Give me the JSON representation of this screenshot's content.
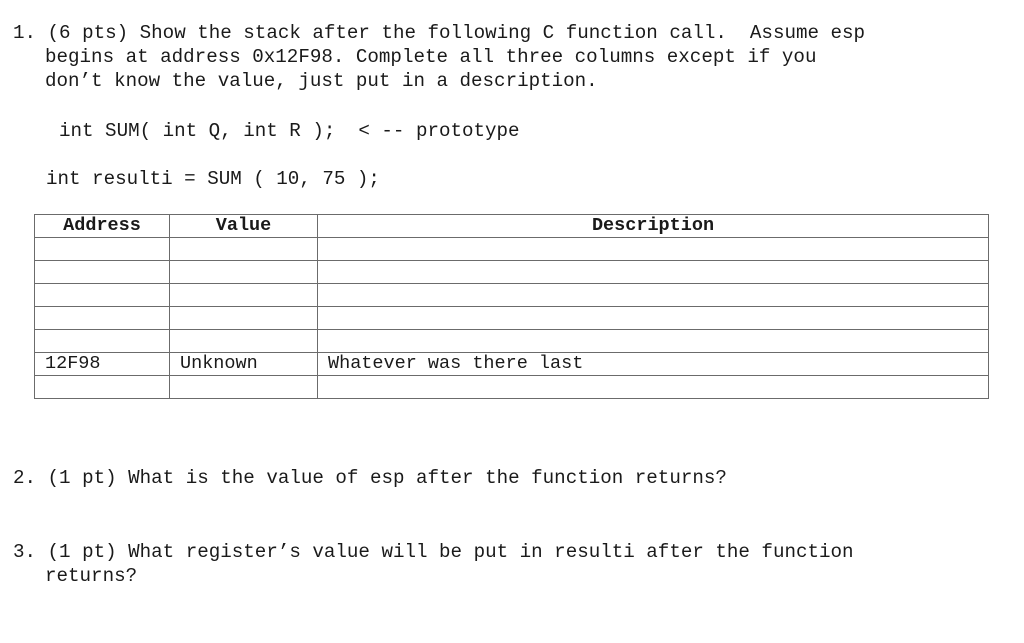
{
  "question1": {
    "lines": [
      "1. (6 pts) Show the stack after the following C function call.  Assume esp",
      "begins at address 0x12F98. Complete all three columns except if you",
      "don’t know the value, just put in a description."
    ],
    "code_prototype": "int SUM( int Q, int R );  < -- prototype",
    "code_call": "int resulti = SUM ( 10, 75 );"
  },
  "stack_table": {
    "headers": [
      "Address",
      "Value",
      "Description"
    ],
    "rows": [
      [
        "",
        "",
        ""
      ],
      [
        "",
        "",
        ""
      ],
      [
        "",
        "",
        ""
      ],
      [
        "",
        "",
        ""
      ],
      [
        "",
        "",
        ""
      ],
      [
        "12F98",
        "Unknown",
        "Whatever was there last"
      ],
      [
        "",
        "",
        ""
      ]
    ]
  },
  "question2": {
    "text": "2. (1 pt) What is the value of esp after the function returns?"
  },
  "question3": {
    "lines": [
      "3. (1 pt) What register’s value will be put in resulti after the function",
      "returns?"
    ]
  }
}
